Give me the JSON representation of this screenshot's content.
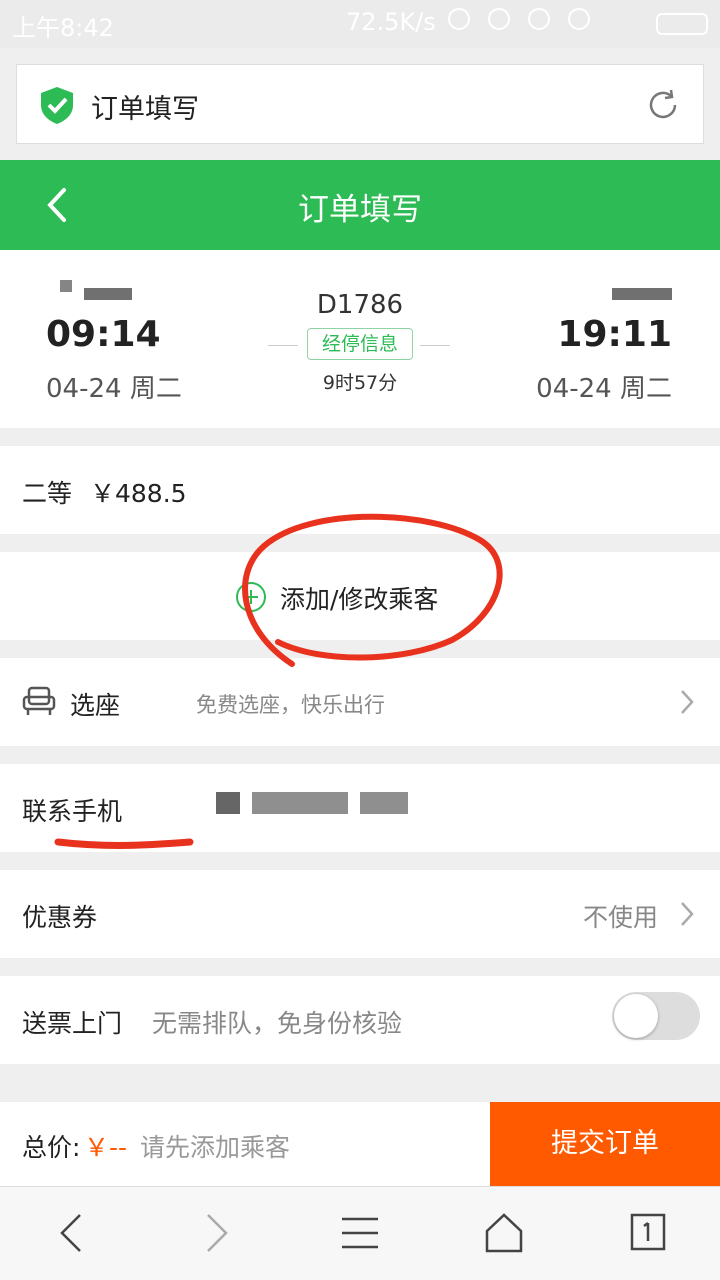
{
  "status_bar": {
    "time": "上午8:42",
    "speed": "72.5K/s"
  },
  "browser": {
    "title": "订单填写"
  },
  "header": {
    "title": "订单填写"
  },
  "train": {
    "number": "D1786",
    "stops_label": "经停信息",
    "duration": "9时57分",
    "departure_time": "09:14",
    "departure_date": "04-24 周二",
    "arrival_time": "19:11",
    "arrival_date": "04-24 周二"
  },
  "seat_class": {
    "label": "二等",
    "price": "￥488.5"
  },
  "passenger": {
    "label": "添加/修改乘客"
  },
  "seat_select": {
    "label": "选座",
    "hint": "免费选座，快乐出行"
  },
  "contact": {
    "label": "联系手机"
  },
  "coupon": {
    "label": "优惠券",
    "value": "不使用"
  },
  "delivery": {
    "label": "送票上门",
    "hint": "无需排队，免身份核验",
    "enabled": false
  },
  "footer": {
    "total_label": "总价:",
    "total_value": "￥--",
    "hint": "请先添加乘客",
    "submit": "提交订单"
  },
  "colors": {
    "brand_green": "#2dbb55",
    "accent_orange": "#ff5a00",
    "annotation_red": "#e8321e"
  }
}
